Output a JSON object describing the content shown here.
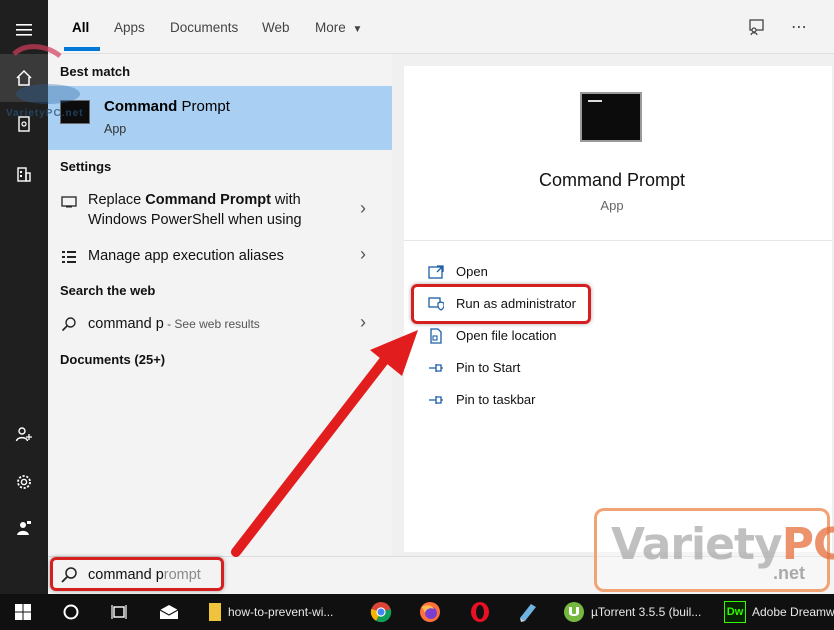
{
  "tabs": {
    "all": "All",
    "apps": "Apps",
    "documents": "Documents",
    "web": "Web",
    "more": "More"
  },
  "results": {
    "best_match_heading": "Best match",
    "best_match": {
      "title_bold_1": "Command",
      "title_mid": " ",
      "title_bold_2": "Prompt",
      "subtitle": "App"
    },
    "settings_heading": "Settings",
    "settings_items": [
      {
        "line1_pre": "Replace ",
        "line1_bold": "Command Prompt",
        "line1_post": " with",
        "line2": "Windows PowerShell when using"
      },
      {
        "label": "Manage app execution aliases"
      }
    ],
    "web_heading": "Search the web",
    "web_item": {
      "query": "command p",
      "suffix": " - See web results"
    },
    "documents_heading": "Documents (25+)"
  },
  "details": {
    "title": "Command Prompt",
    "subtitle": "App",
    "actions": [
      {
        "label": "Open",
        "icon": "open-window-icon"
      },
      {
        "label": "Run as administrator",
        "icon": "shield-icon"
      },
      {
        "label": "Open file location",
        "icon": "file-location-icon"
      },
      {
        "label": "Pin to Start",
        "icon": "pin-icon"
      },
      {
        "label": "Pin to taskbar",
        "icon": "pin-icon"
      }
    ]
  },
  "search": {
    "typed": "command p",
    "ghost": "rompt"
  },
  "taskbar": {
    "items": [
      {
        "label": "how-to-prevent-wi..."
      },
      {
        "label": "µTorrent 3.5.5  (buil..."
      },
      {
        "label": "Adobe Dreamw"
      }
    ],
    "dw_badge": "Dw"
  },
  "watermark": {
    "main": "Variety",
    "pc": "PC",
    "net": ".net",
    "small": "VarietyPC.net"
  },
  "colors": {
    "accent": "#0078d7",
    "selection": "#a9d0f2",
    "highlight": "#d61f1f",
    "arrow": "#e21d1d"
  }
}
